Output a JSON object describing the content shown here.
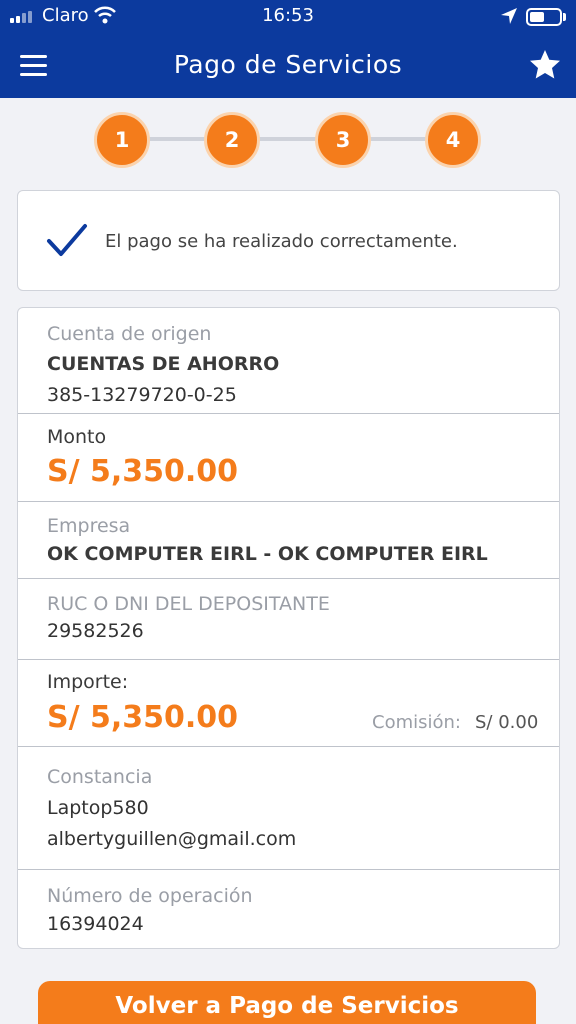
{
  "status_bar": {
    "carrier": "Claro",
    "time": "16:53"
  },
  "header": {
    "title": "Pago de Servicios",
    "menu_icon": "hamburger-menu-icon",
    "favorite_icon": "star-icon"
  },
  "stepper": {
    "steps": [
      "1",
      "2",
      "3",
      "4"
    ],
    "active_color": "#f47c1b"
  },
  "confirmation": {
    "message": "El pago se ha realizado correctamente.",
    "icon": "checkmark-icon"
  },
  "details": {
    "source_account": {
      "label": "Cuenta de origen",
      "type": "CUENTAS DE AHORRO",
      "number": "385-13279720-0-25"
    },
    "amount": {
      "label": "Monto",
      "value": "S/ 5,350.00"
    },
    "company": {
      "label": "Empresa",
      "value": "OK COMPUTER EIRL - OK COMPUTER EIRL"
    },
    "depositor": {
      "label": "RUC O DNI DEL DEPOSITANTE",
      "value": "29582526"
    },
    "import": {
      "label": "Importe:",
      "value": "S/ 5,350.00",
      "fee_label": "Comisión:",
      "fee_value": "S/ 0.00"
    },
    "receipt": {
      "label": "Constancia",
      "line1": "Laptop580",
      "line2": "albertyguillen@gmail.com"
    },
    "operation": {
      "label": "Número de operación",
      "value": "16394024"
    }
  },
  "actions": {
    "back_label": "Volver a Pago de Servicios"
  },
  "colors": {
    "header_bg": "#0c3a9e",
    "accent": "#f47c1b",
    "page_bg": "#f1f2f6"
  }
}
